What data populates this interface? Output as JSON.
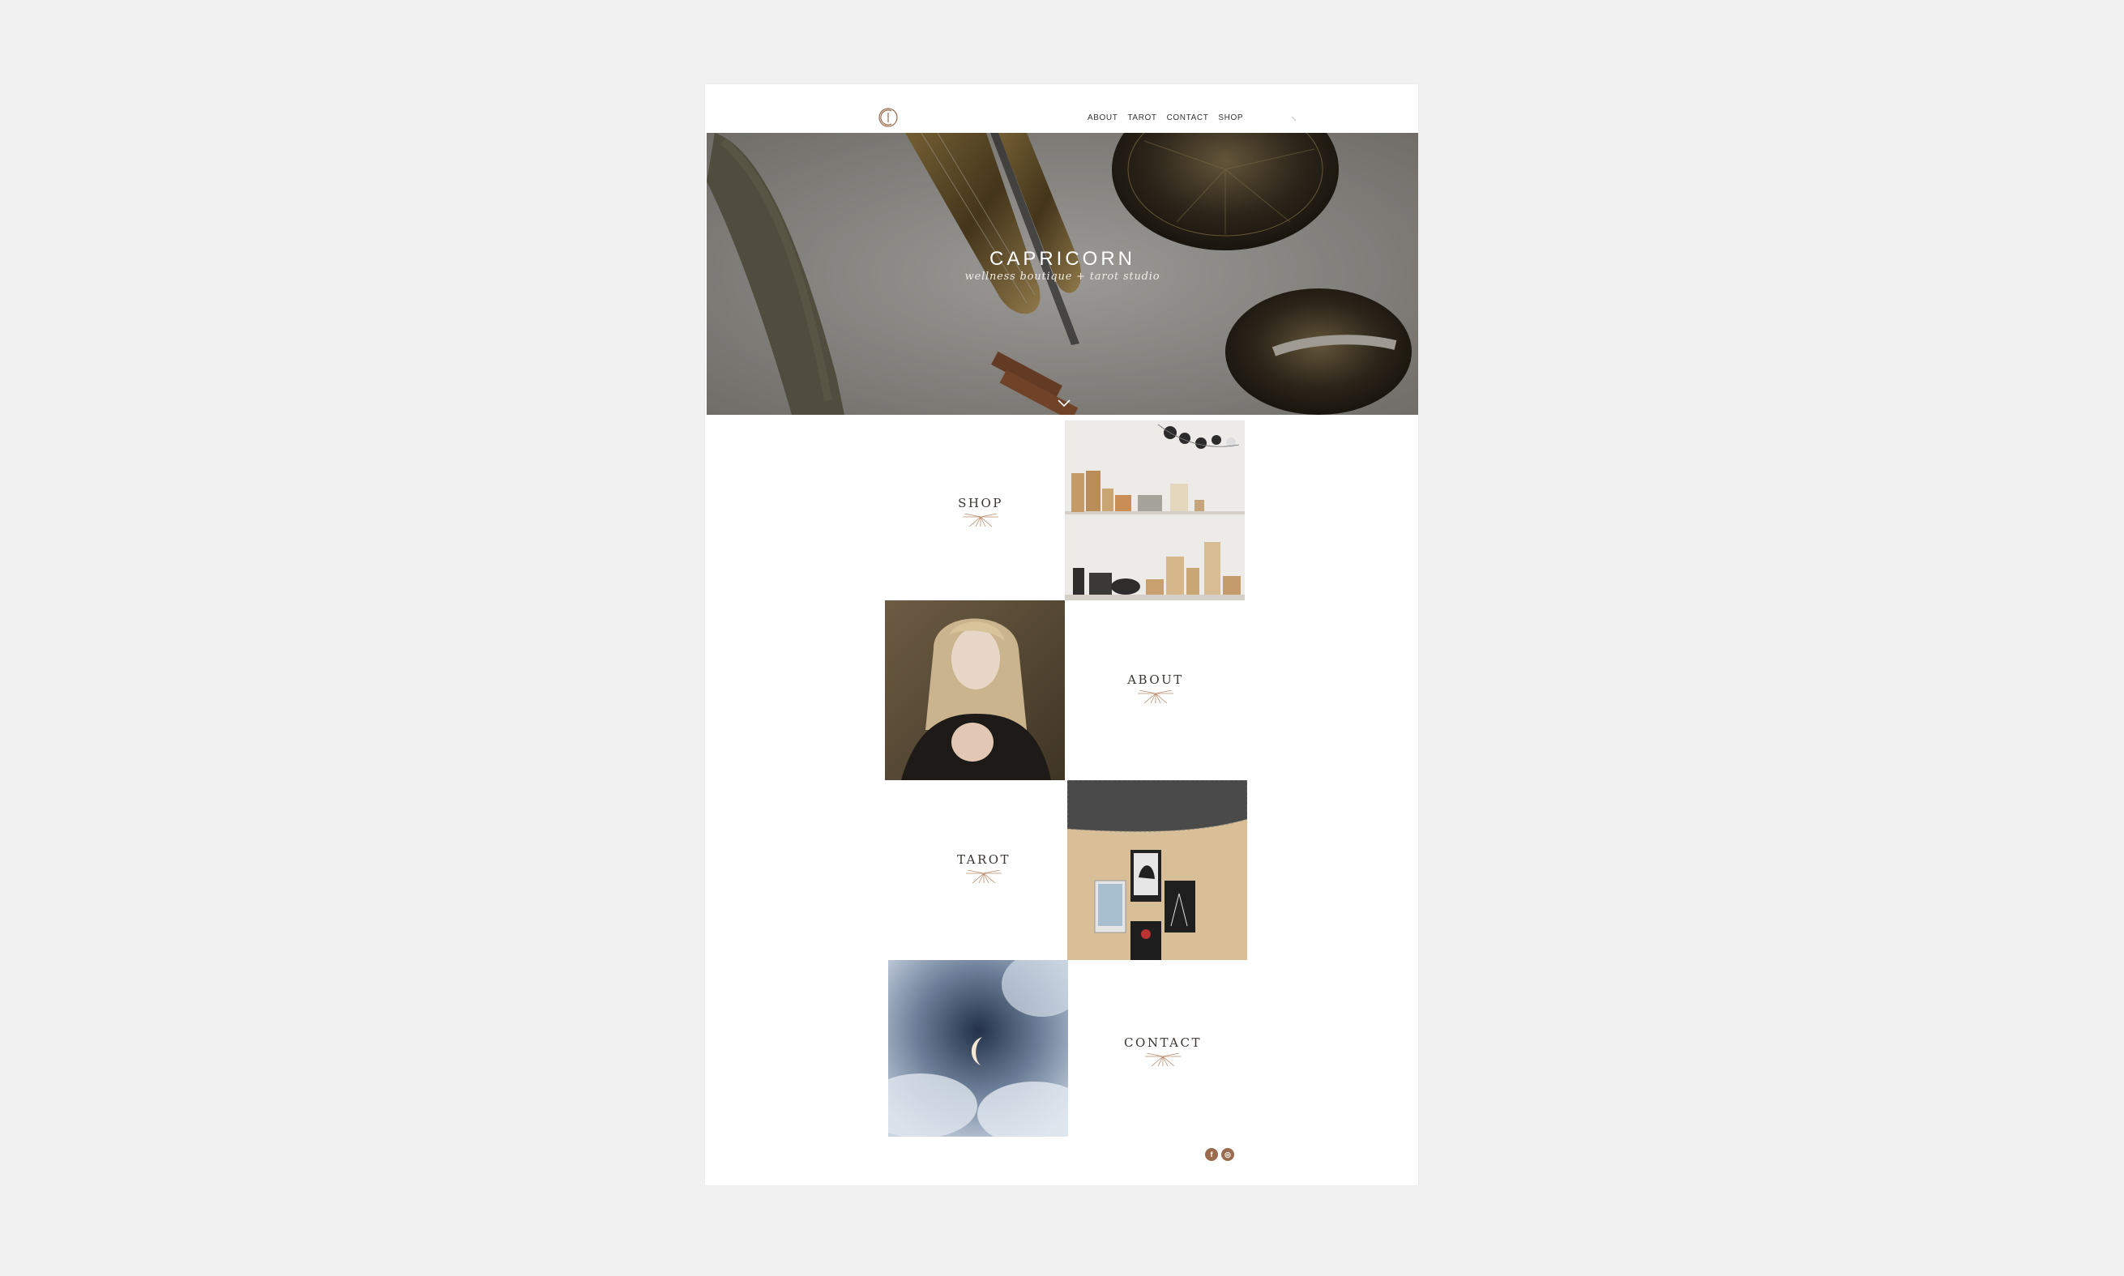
{
  "brand": {
    "name": "CAPRICORN",
    "tagline": "wellness boutique + tarot studio",
    "accent_color": "#9a6b4e"
  },
  "nav": {
    "items": [
      "ABOUT",
      "TAROT",
      "CONTACT",
      "SHOP"
    ]
  },
  "hero": {
    "scroll_icon": "chevron-down-icon"
  },
  "sections": [
    {
      "label": "SHOP",
      "image": "shop-shelves-photo"
    },
    {
      "label": "ABOUT",
      "image": "woman-portrait-photo"
    },
    {
      "label": "TAROT",
      "image": "tarot-cards-photo"
    },
    {
      "label": "CONTACT",
      "image": "moon-clouds-photo"
    }
  ],
  "footer": {
    "social": [
      "f",
      "◎"
    ]
  }
}
